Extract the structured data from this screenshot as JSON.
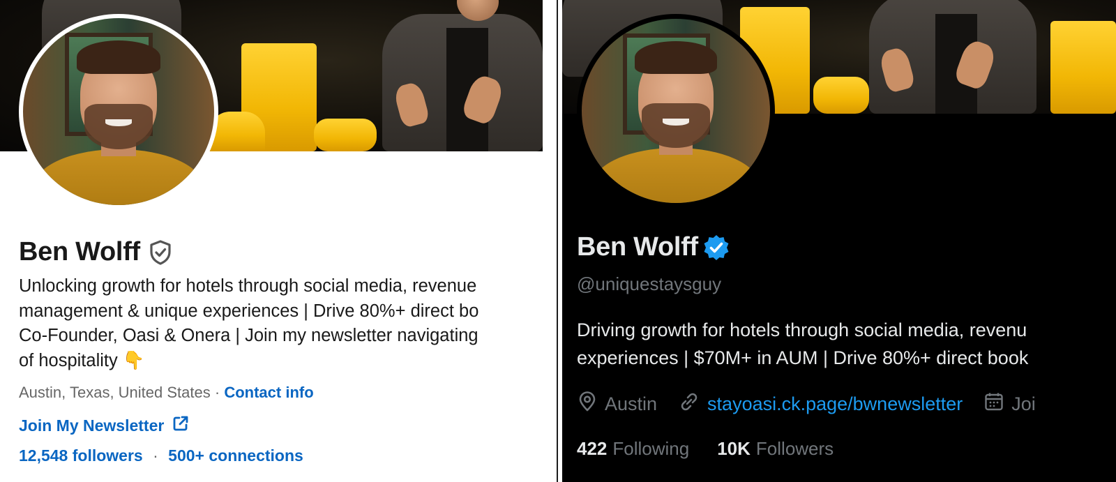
{
  "linkedin": {
    "name": "Ben Wolff",
    "headline_lines": [
      "Unlocking growth for hotels through social media, revenue",
      "management & unique experiences | Drive 80%+ direct bo",
      "Co-Founder, Oasi & Onera | Join my newsletter navigating",
      "of hospitality 👇"
    ],
    "location": "Austin, Texas, United States",
    "location_sep": "·",
    "contact_info": "Contact info",
    "newsletter_link": "Join My Newsletter",
    "followers": "12,548 followers",
    "stats_sep": "·",
    "connections": "500+ connections",
    "icons": [
      "verified-shield-icon",
      "external-link-icon"
    ],
    "colors": {
      "link": "#0a66c2",
      "text": "#191919",
      "muted": "#666666"
    }
  },
  "twitter": {
    "name": "Ben Wolff",
    "handle": "@uniquestaysguy",
    "bio_lines": [
      "Driving growth for hotels through social media, revenu",
      "experiences | $70M+ in AUM | Drive 80%+ direct book"
    ],
    "location": "Austin",
    "website": "stayoasi.ck.page/bwnewsletter",
    "joined": "Joi",
    "following_count": "422",
    "following_label": "Following",
    "followers_count": "10K",
    "followers_label": "Followers",
    "icons": [
      "verified-badge-icon",
      "location-pin-icon",
      "link-icon",
      "calendar-icon"
    ],
    "colors": {
      "link": "#1d9bf0",
      "text": "#e7e9ea",
      "muted": "#71767b",
      "badge": "#1d9bf0"
    }
  }
}
